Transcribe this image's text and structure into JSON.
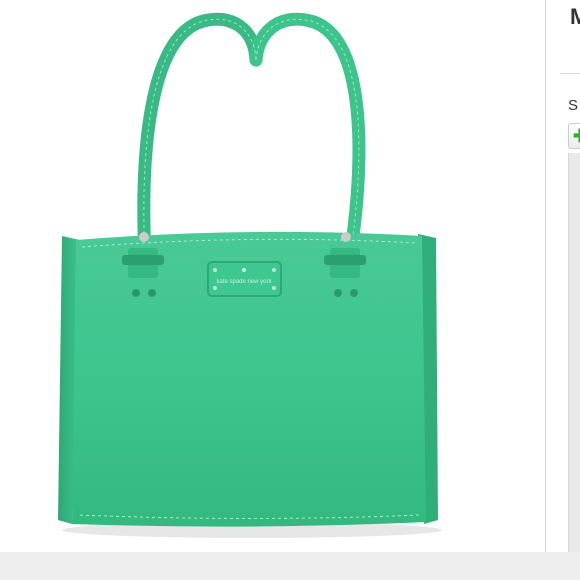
{
  "side_panel": {
    "title": "M",
    "label": "S",
    "button_icon": "plus-icon",
    "accent_color": "#2fae2f"
  },
  "product": {
    "brand_plate_text": "kate spade new york",
    "bag_color": "#3cc48c"
  }
}
